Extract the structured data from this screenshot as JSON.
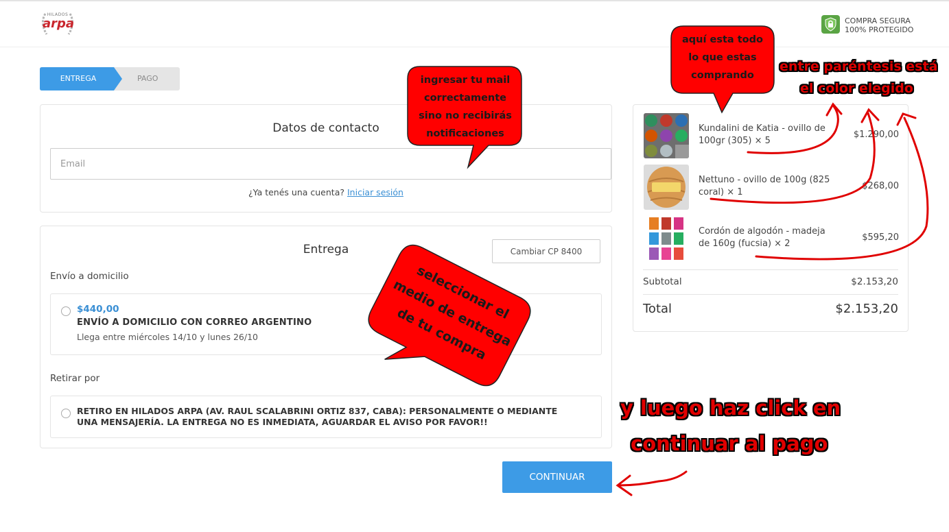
{
  "header": {
    "logo_small": "HILADOS",
    "logo_main": "arpa",
    "secure_title": "COMPRA SEGURA",
    "secure_subtitle": "100% PROTEGIDO"
  },
  "steps": [
    {
      "label": "ENTREGA",
      "active": true
    },
    {
      "label": "PAGO",
      "active": false
    }
  ],
  "contact": {
    "title": "Datos de contacto",
    "email_placeholder": "Email",
    "email_value": "",
    "account_prompt": "¿Ya tenés una cuenta?",
    "login_link": "Iniciar sesión"
  },
  "delivery": {
    "title": "Entrega",
    "change_cp_button": "Cambiar CP 8400",
    "home_section_label": "Envío a domicilio",
    "home_option": {
      "price": "$440,00",
      "name": "ENVÍO A DOMICILIO CON CORREO ARGENTINO",
      "eta": "Llega entre miércoles 14/10 y lunes 26/10"
    },
    "pickup_section_label": "Retirar por",
    "pickup_option": {
      "name": "RETIRO EN HILADOS ARPA (AV. RAUL SCALABRINI ORTIZ 837, CABA): PERSONALMENTE O MEDIANTE UNA MENSAJERÍA. LA ENTREGA NO ES INMEDIATA, AGUARDAR EL AVISO POR FAVOR!!"
    }
  },
  "continue_button": "CONTINUAR",
  "summary": {
    "items": [
      {
        "name": "Kundalini de Katia - ovillo de 100gr (305) × 5",
        "price": "$1.290,00",
        "thumb": "yarn-grid-multicolor-icon"
      },
      {
        "name": "Nettuno - ovillo de 100g (825 coral) × 1",
        "price": "$268,00",
        "thumb": "yarn-ball-coral-icon"
      },
      {
        "name": "Cordón de algodón - madeja de 160g (fucsia) × 2",
        "price": "$595,20",
        "thumb": "yarn-skeins-grid-icon"
      }
    ],
    "subtotal_label": "Subtotal",
    "subtotal_value": "$2.153,20",
    "total_label": "Total",
    "total_value": "$2.153,20"
  },
  "annotations": {
    "email_bubble": [
      "ingresar tu mail",
      "correctamente",
      "sino no recibirás",
      "notificaciones"
    ],
    "items_bubble": [
      "aquí esta todo",
      "lo que estas",
      "comprando"
    ],
    "color_note": [
      "entre paréntesis está",
      "el color elegido"
    ],
    "delivery_bubble": [
      "seleccionar el",
      "medio de entrega",
      "de tu compra"
    ],
    "continue_note": [
      "y luego haz click en",
      "continuar al pago"
    ],
    "annotation_color": "#ff0000"
  },
  "colors": {
    "accent": "#3d9be6",
    "link": "#3a8fd4",
    "brand_red": "#c9252c",
    "secure_green": "#5aa444"
  }
}
